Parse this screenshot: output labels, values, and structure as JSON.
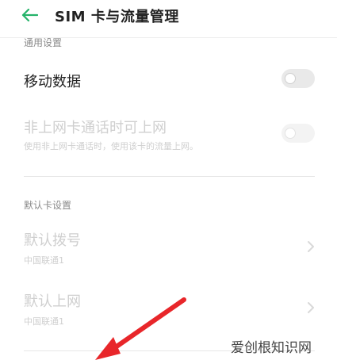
{
  "header": {
    "back_icon": "back-arrow-icon",
    "title": "SIM 卡与流量管理",
    "accent": "#25b36a"
  },
  "general": {
    "section_label": "通用设置",
    "mobile_data": {
      "label": "移动数据",
      "enabled": false
    },
    "non_data_card": {
      "label": "非上网卡通话时可上网",
      "desc": "使用非上网卡通话时，使用该卡的流量上网。",
      "enabled": false,
      "disabled": true
    }
  },
  "default_card": {
    "section_label": "默认卡设置",
    "dial": {
      "label": "默认拨号",
      "value": "中国联通1"
    },
    "internet": {
      "label": "默认上网",
      "value": "中国联通1"
    }
  },
  "watermark": "爱创根知识网",
  "annotation_color": "#e8262a"
}
